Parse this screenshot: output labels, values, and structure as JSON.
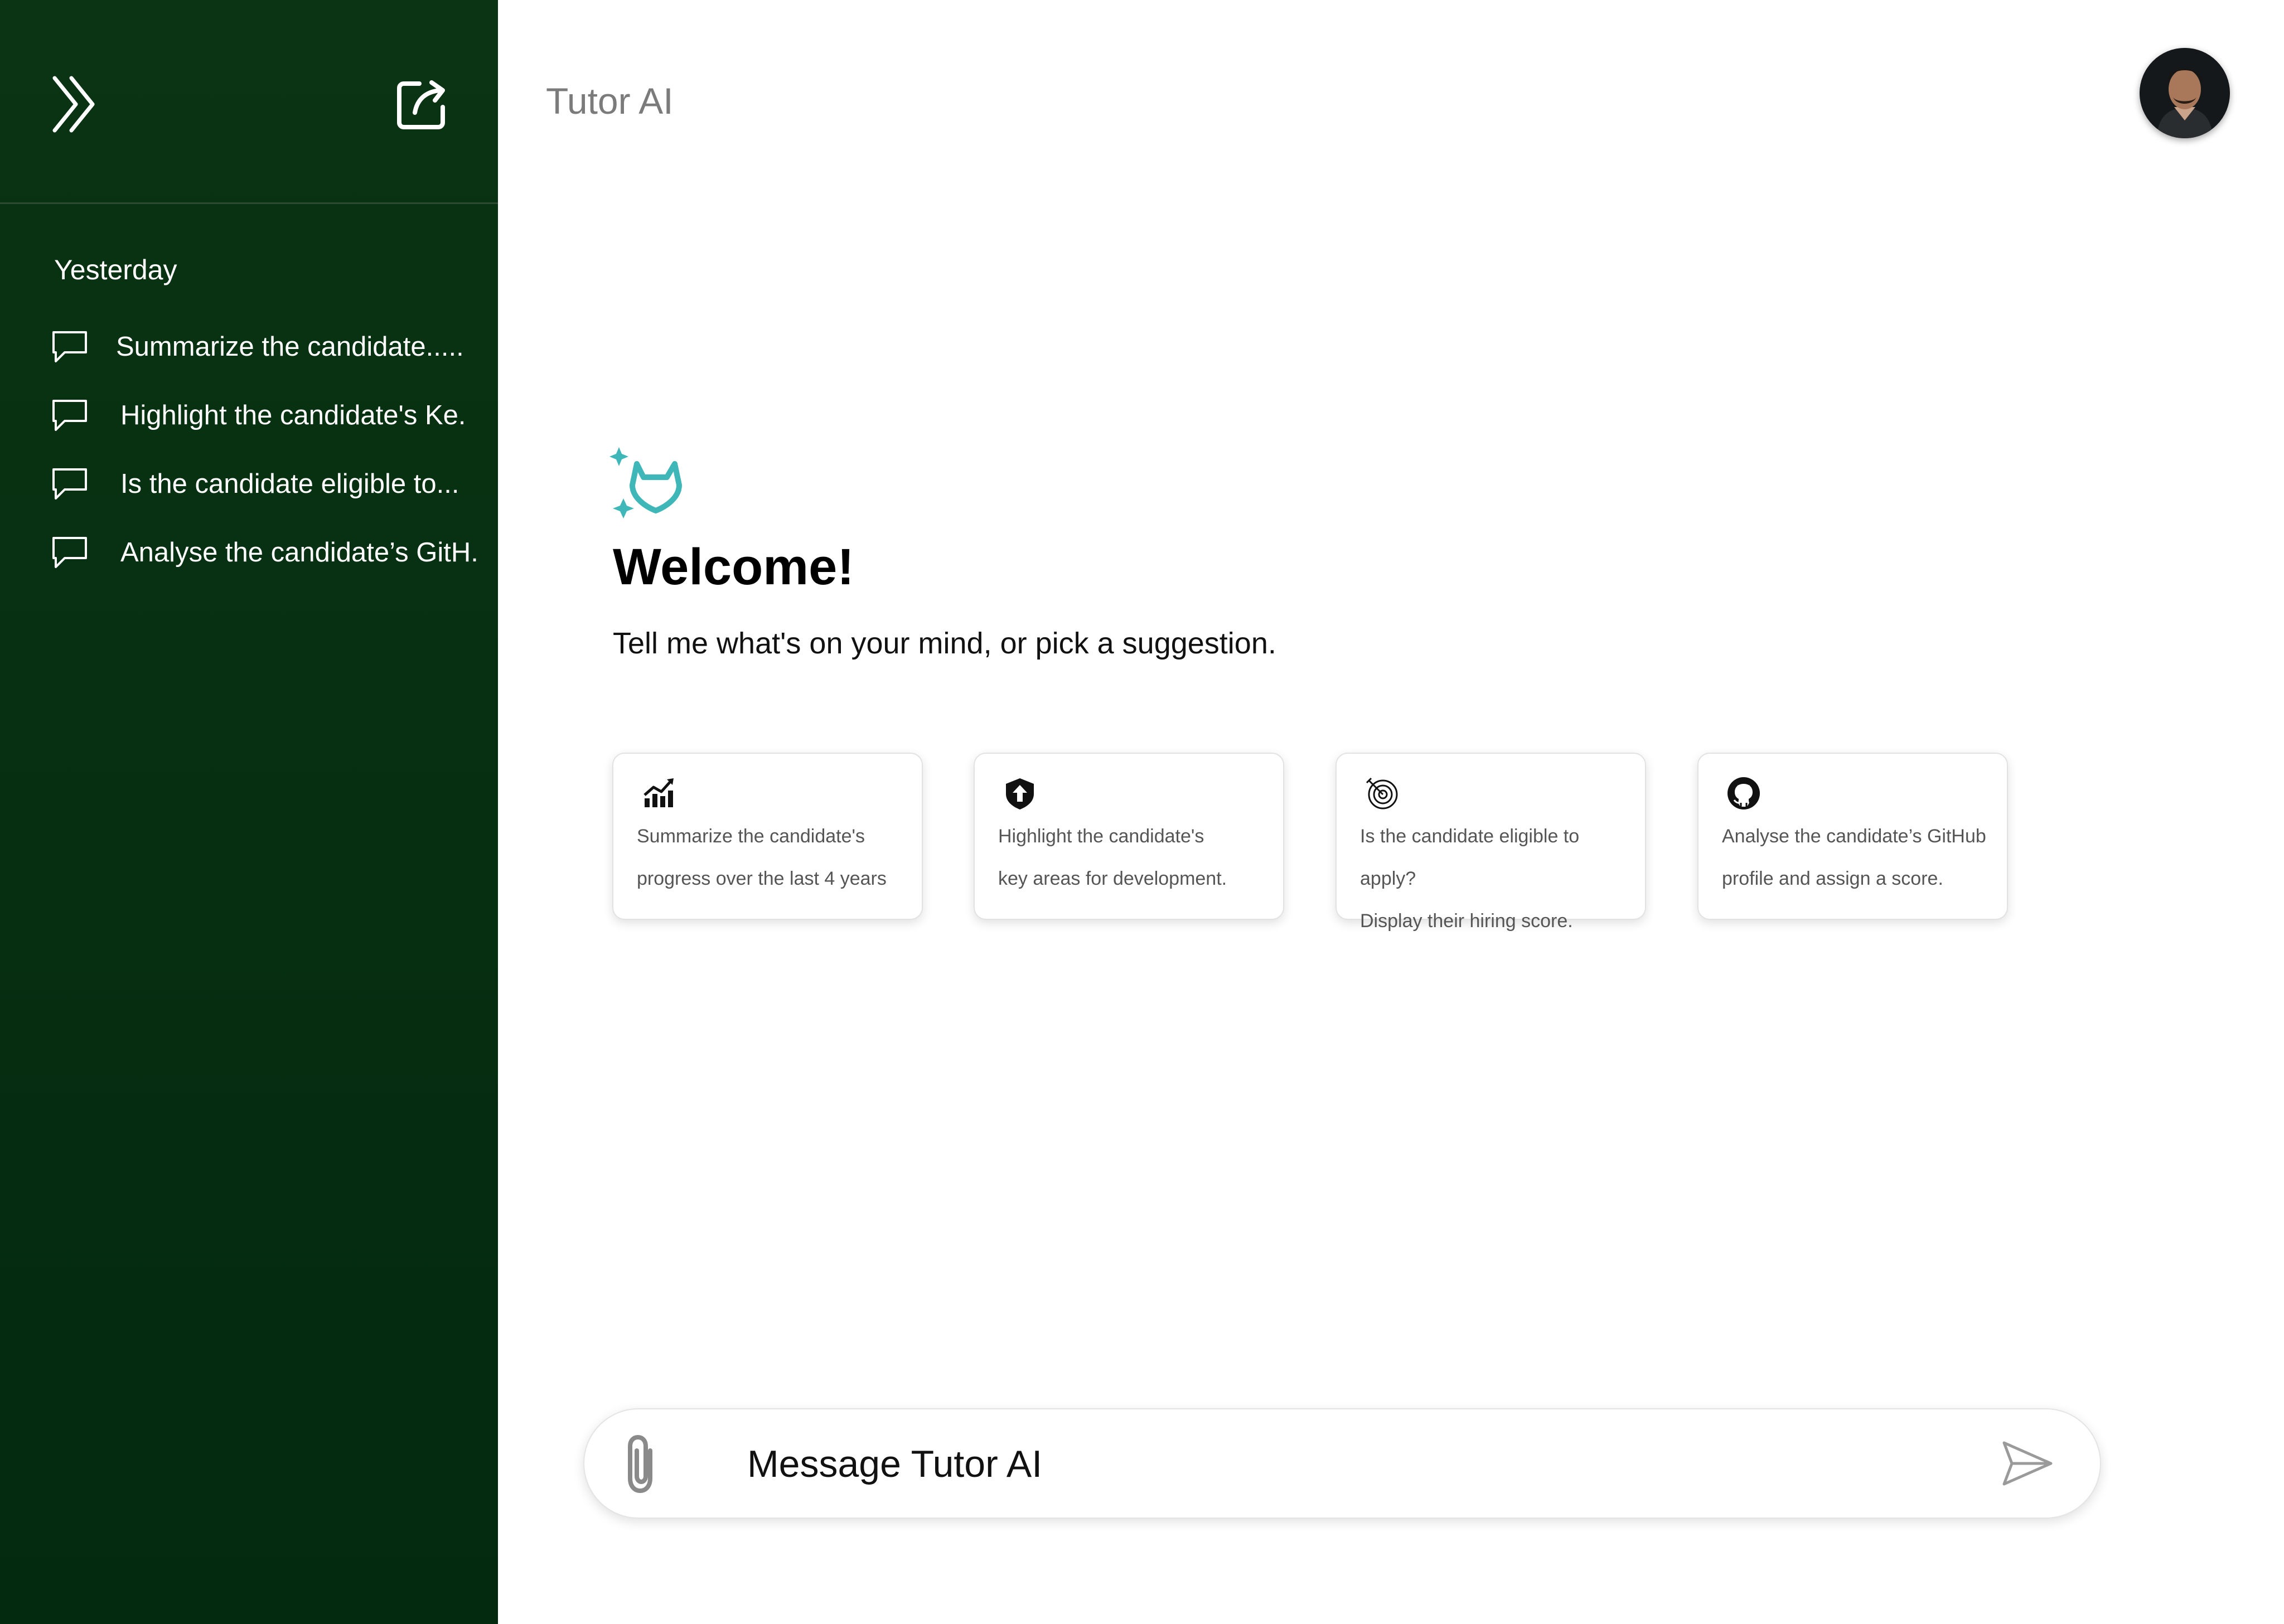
{
  "app": {
    "title": "Tutor AI"
  },
  "sidebar": {
    "history_heading": "Yesterday",
    "items": [
      {
        "label": "Summarize the candidate....."
      },
      {
        "label": "Highlight the candidate's Ke."
      },
      {
        "label": "Is the candidate eligible to..."
      },
      {
        "label": "Analyse the candidate’s GitH."
      }
    ],
    "icons": {
      "collapse": "double-chevron-right-icon",
      "new_chat": "external-link-icon",
      "chat": "chat-bubble-icon"
    }
  },
  "welcome": {
    "title": "Welcome!",
    "subtitle": "Tell me what's on your mind, or pick a suggestion.",
    "logo_icon": "sparkle-fox-logo-icon"
  },
  "suggestions": [
    {
      "icon": "bar-chart-icon",
      "line1": "Summarize the candidate's",
      "line2": "progress over the last 4 years"
    },
    {
      "icon": "shield-arrow-icon",
      "line1": "Highlight the candidate's",
      "line2": "key areas for development."
    },
    {
      "icon": "target-icon",
      "line1": "Is the candidate eligible to apply?",
      "line2": "Display their hiring score."
    },
    {
      "icon": "github-icon",
      "line1": "Analyse the candidate’s GitHub",
      "line2": "profile and assign a score."
    }
  ],
  "composer": {
    "placeholder": "Message Tutor AI",
    "attach_icon": "paperclip-icon",
    "send_icon": "send-icon"
  },
  "colors": {
    "sidebar_bg": "#03290f",
    "accent_teal": "#3fb6b8",
    "title_gray": "#7b7b7b"
  }
}
